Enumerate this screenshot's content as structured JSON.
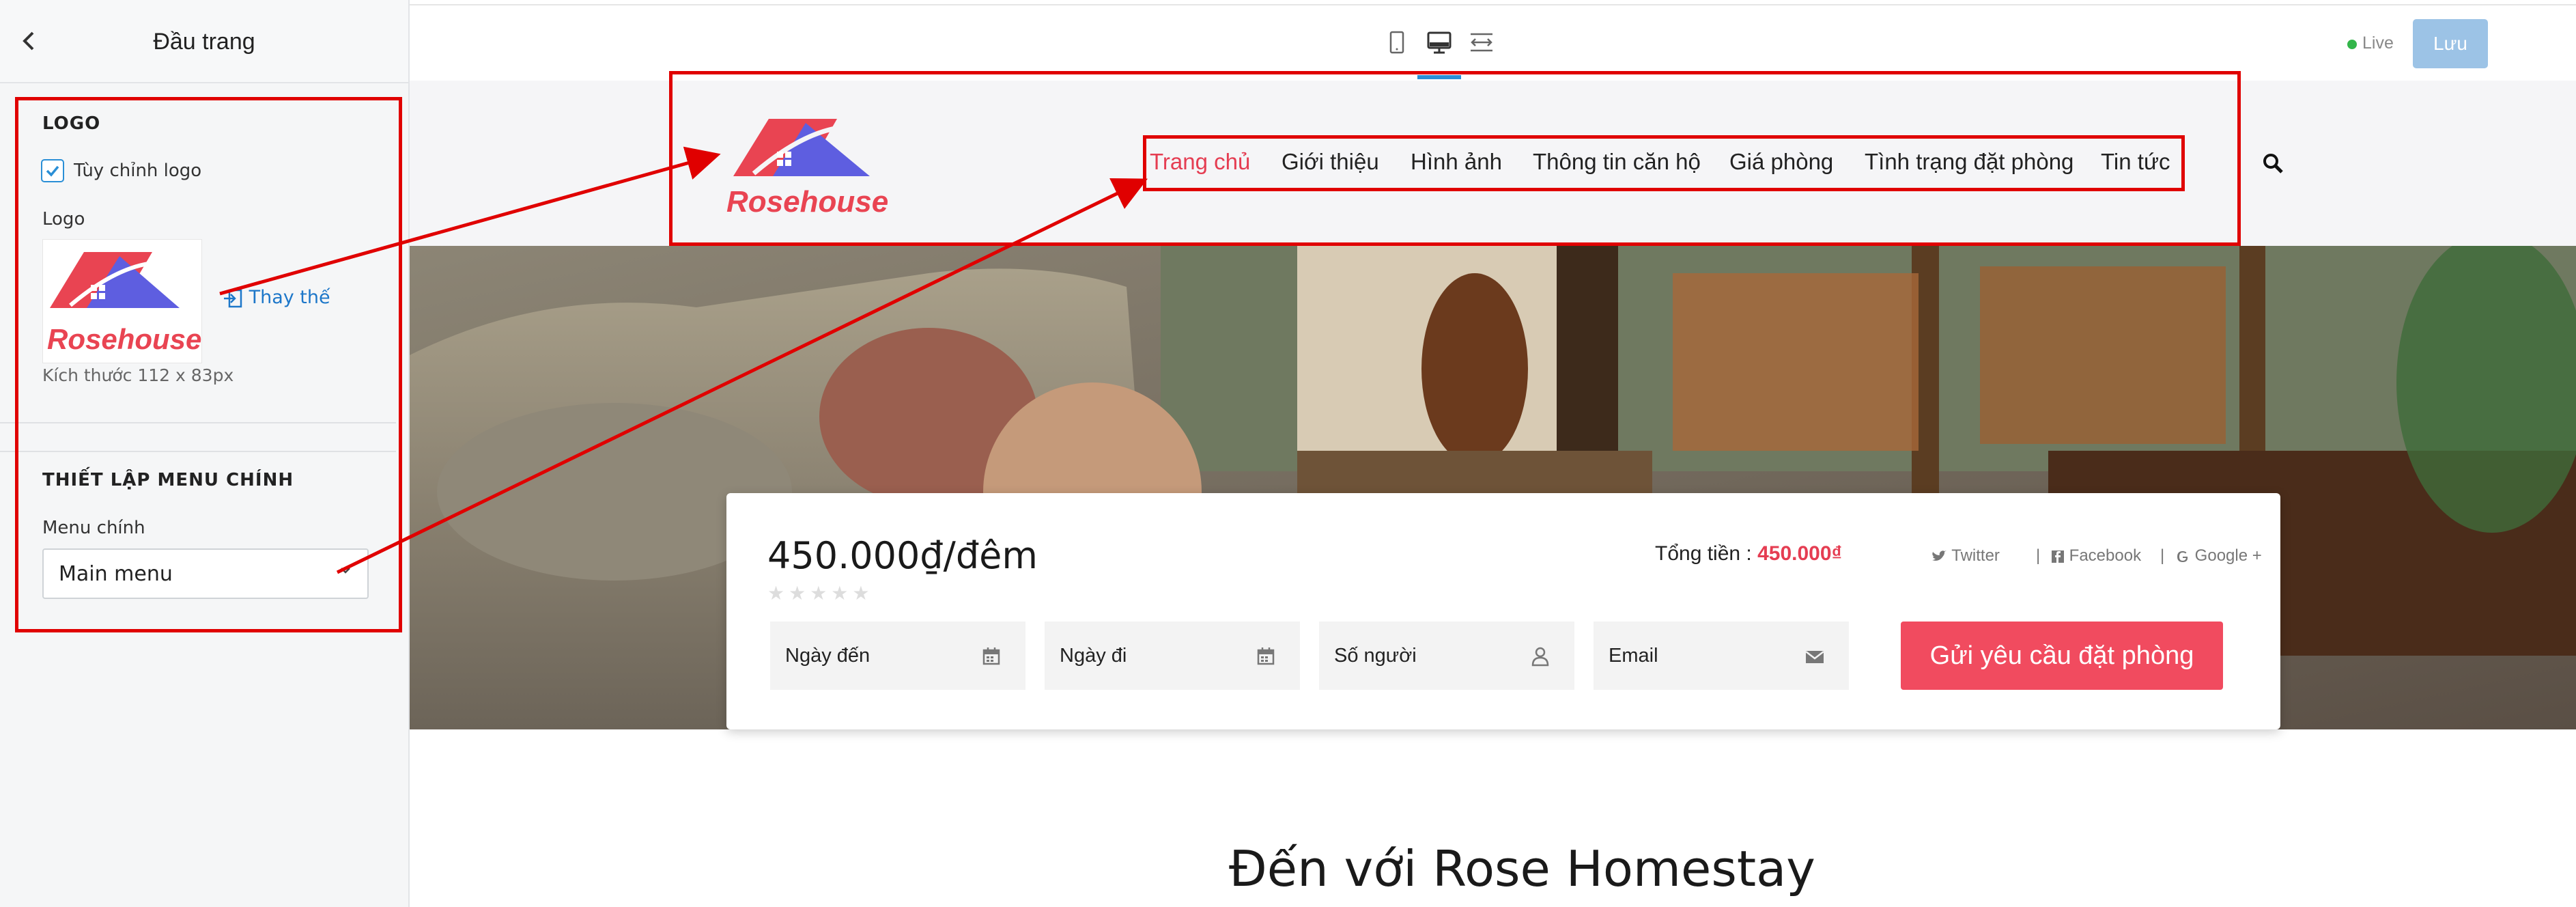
{
  "panel": {
    "title": "Đầu trang",
    "back_icon": "chevron-left-icon",
    "logo_section": {
      "heading": "LOGO",
      "checkbox_label": "Tùy chỉnh logo",
      "checkbox_checked": true,
      "field_label": "Logo",
      "replace_label": "Thay thế",
      "size_note": "Kích thước 112 x 83px"
    },
    "menu_section": {
      "heading": "THIẾT LẬP MENU CHÍNH",
      "field_label": "Menu chính",
      "selected": "Main menu"
    }
  },
  "toolbar": {
    "device_icons": [
      "tablet-icon",
      "desktop-icon",
      "fullwidth-icon"
    ],
    "live_label": "Live",
    "save_label": "Lưu"
  },
  "site": {
    "logo_text": "Rosehouse",
    "nav": [
      "Trang chủ",
      "Giới thiệu",
      "Hình ảnh",
      "Thông tin căn hộ",
      "Giá phòng",
      "Tình trạng đặt phòng",
      "Tin tức"
    ],
    "active_nav": "Trang chủ"
  },
  "booking": {
    "price": "450.000₫/đêm",
    "total_label": "Tổng tiền :",
    "total_value": "450.000₫",
    "share": [
      "Twitter",
      "Facebook",
      "Google +"
    ],
    "fields": [
      "Ngày đến",
      "Ngày đi",
      "Số người",
      "Email"
    ],
    "submit_label": "Gửi yêu cầu đặt phòng"
  },
  "section_heading": "Đến với Rose Homestay",
  "colors": {
    "accent_red": "#e53d52",
    "annotation_red": "#e00000",
    "link_blue": "#1d77c9",
    "save_button": "#9cc3e6"
  }
}
